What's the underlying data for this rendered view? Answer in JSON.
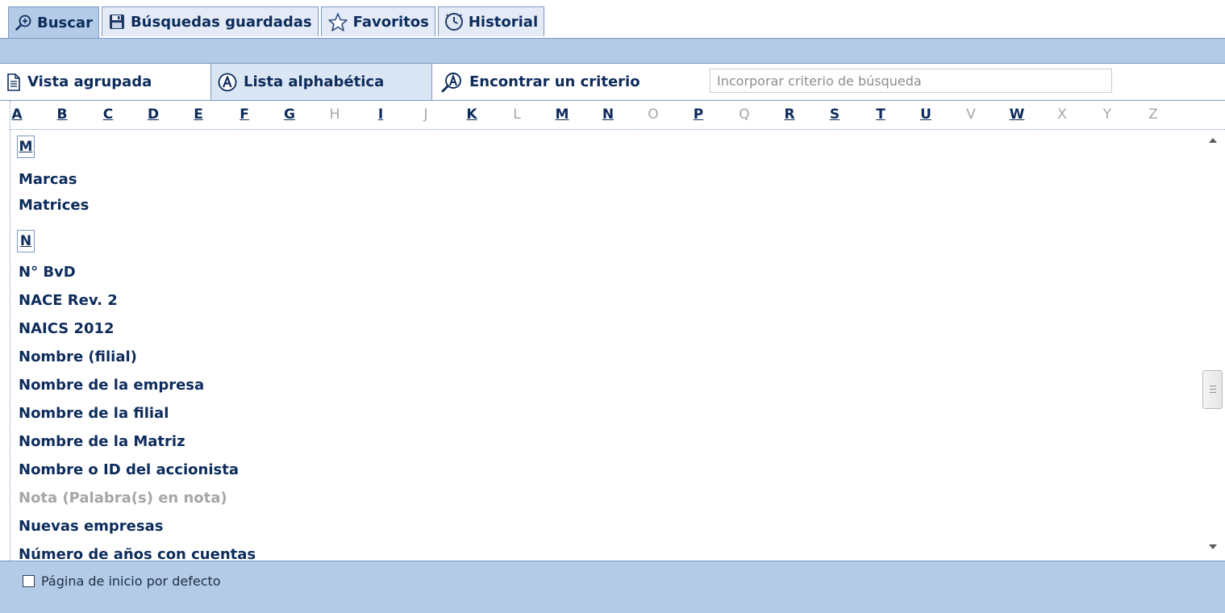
{
  "tabs": [
    {
      "label": "Buscar",
      "icon": "search-plus-icon",
      "active": true
    },
    {
      "label": "Búsquedas guardadas",
      "icon": "floppy-disk-icon",
      "active": false
    },
    {
      "label": "Favoritos",
      "icon": "star-icon",
      "active": false
    },
    {
      "label": "Historial",
      "icon": "clock-icon",
      "active": false
    }
  ],
  "toolbar": {
    "grouped_label": "Vista agrupada",
    "alpha_label": "Lista alphabética",
    "find_label": "Encontrar un criterio",
    "search_placeholder": "Incorporar criterio de búsqueda",
    "search_value": ""
  },
  "letters": [
    {
      "l": "A",
      "enabled": true
    },
    {
      "l": "B",
      "enabled": true
    },
    {
      "l": "C",
      "enabled": true
    },
    {
      "l": "D",
      "enabled": true
    },
    {
      "l": "E",
      "enabled": true
    },
    {
      "l": "F",
      "enabled": true
    },
    {
      "l": "G",
      "enabled": true
    },
    {
      "l": "H",
      "enabled": false
    },
    {
      "l": "I",
      "enabled": true
    },
    {
      "l": "J",
      "enabled": false
    },
    {
      "l": "K",
      "enabled": true
    },
    {
      "l": "L",
      "enabled": false
    },
    {
      "l": "M",
      "enabled": true
    },
    {
      "l": "N",
      "enabled": true
    },
    {
      "l": "O",
      "enabled": false
    },
    {
      "l": "P",
      "enabled": true
    },
    {
      "l": "Q",
      "enabled": false
    },
    {
      "l": "R",
      "enabled": true
    },
    {
      "l": "S",
      "enabled": true
    },
    {
      "l": "T",
      "enabled": true
    },
    {
      "l": "U",
      "enabled": true
    },
    {
      "l": "V",
      "enabled": false
    },
    {
      "l": "W",
      "enabled": true
    },
    {
      "l": "X",
      "enabled": false
    },
    {
      "l": "Y",
      "enabled": false
    },
    {
      "l": "Z",
      "enabled": false
    }
  ],
  "list": {
    "m_header": "M",
    "n_header": "N",
    "m_items": [
      "Marcas",
      "Matrices"
    ],
    "n_items": [
      {
        "label": "N° BvD",
        "enabled": true
      },
      {
        "label": "NACE Rev. 2",
        "enabled": true
      },
      {
        "label": "NAICS 2012",
        "enabled": true
      },
      {
        "label": "Nombre (filial)",
        "enabled": true
      },
      {
        "label": "Nombre de la empresa",
        "enabled": true
      },
      {
        "label": "Nombre de la filial",
        "enabled": true
      },
      {
        "label": "Nombre de la Matriz",
        "enabled": true
      },
      {
        "label": "Nombre o ID del accionista",
        "enabled": true
      },
      {
        "label": "Nota (Palabra(s) en nota)",
        "enabled": false
      },
      {
        "label": "Nuevas empresas",
        "enabled": true
      },
      {
        "label": "Número de años con cuentas",
        "enabled": true
      }
    ]
  },
  "footer": {
    "checkbox_label": "Página de inicio por defecto",
    "checked": false
  },
  "colors": {
    "accent_blue": "#b3cbe7",
    "text_dark_blue": "#0d2c5c",
    "disabled_gray": "#a6a6a6"
  }
}
